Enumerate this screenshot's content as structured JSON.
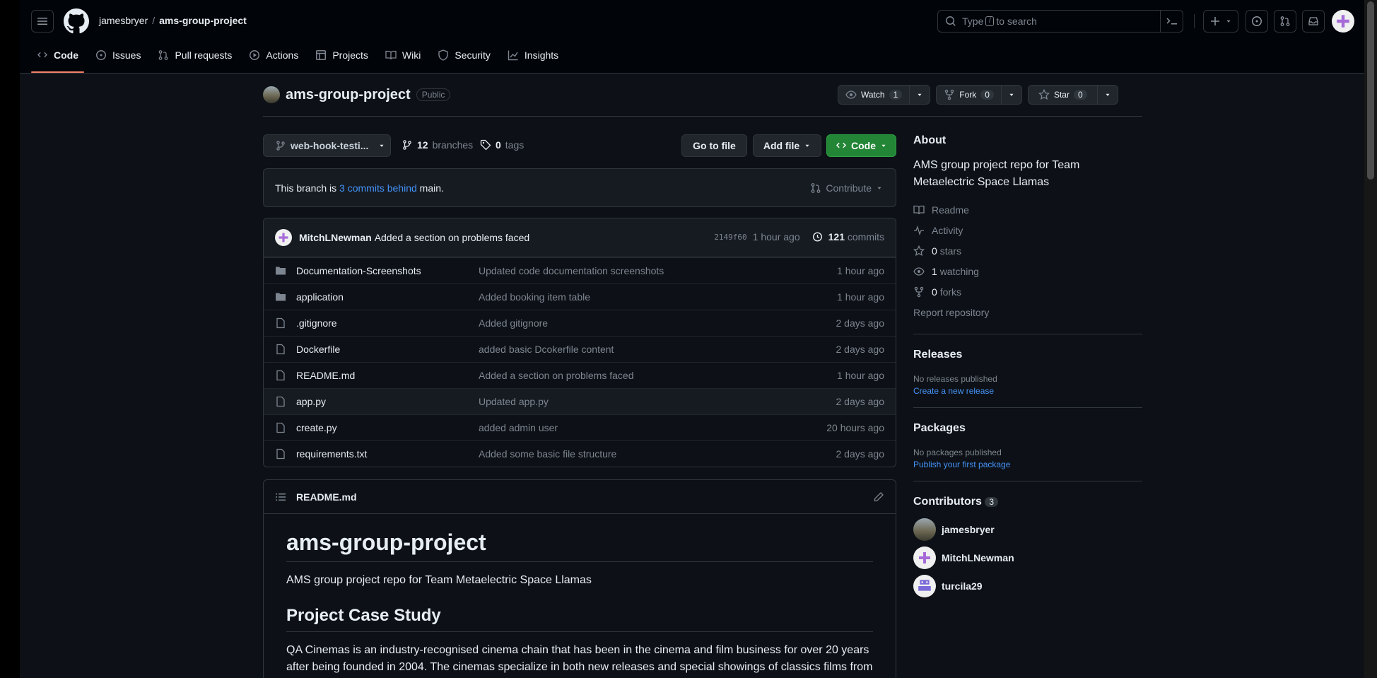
{
  "header": {
    "owner": "jamesbryer",
    "separator": "/",
    "repo": "ams-group-project",
    "search_prefix": "Type",
    "search_key": "/",
    "search_suffix": "to search"
  },
  "tabs": [
    {
      "label": "Code",
      "icon": "code-icon"
    },
    {
      "label": "Issues",
      "icon": "issue-icon"
    },
    {
      "label": "Pull requests",
      "icon": "pull-request-icon"
    },
    {
      "label": "Actions",
      "icon": "play-icon"
    },
    {
      "label": "Projects",
      "icon": "table-icon"
    },
    {
      "label": "Wiki",
      "icon": "book-icon"
    },
    {
      "label": "Security",
      "icon": "shield-icon"
    },
    {
      "label": "Insights",
      "icon": "graph-icon"
    }
  ],
  "repo_title": {
    "name": "ams-group-project",
    "visibility": "Public",
    "watch_label": "Watch",
    "watch_count": "1",
    "fork_label": "Fork",
    "fork_count": "0",
    "star_label": "Star",
    "star_count": "0"
  },
  "branch_bar": {
    "branch": "web-hook-testi...",
    "branches_count": "12",
    "branches_label": "branches",
    "tags_count": "0",
    "tags_label": "tags",
    "goto_label": "Go to file",
    "add_label": "Add file",
    "code_label": "Code"
  },
  "behind": {
    "prefix": "This branch is",
    "link": "3 commits behind",
    "suffix": "main.",
    "contribute": "Contribute"
  },
  "latest_commit": {
    "author": "MitchLNewman",
    "message": "Added a section on problems faced",
    "sha": "2149f60",
    "time": "1 hour ago",
    "commits_count": "121",
    "commits_label": "commits"
  },
  "files": [
    {
      "type": "folder",
      "name": "Documentation-Screenshots",
      "message": "Updated code documentation screenshots",
      "age": "1 hour ago"
    },
    {
      "type": "folder",
      "name": "application",
      "message": "Added booking item table",
      "age": "1 hour ago"
    },
    {
      "type": "file",
      "name": ".gitignore",
      "message": "Added gitignore",
      "age": "2 days ago"
    },
    {
      "type": "file",
      "name": "Dockerfile",
      "message": "added basic Dcokerfile content",
      "age": "2 days ago"
    },
    {
      "type": "file",
      "name": "README.md",
      "message": "Added a section on problems faced",
      "age": "1 hour ago"
    },
    {
      "type": "file",
      "name": "app.py",
      "message": "Updated app.py",
      "age": "2 days ago"
    },
    {
      "type": "file",
      "name": "create.py",
      "message": "added admin user",
      "age": "20 hours ago"
    },
    {
      "type": "file",
      "name": "requirements.txt",
      "message": "Added some basic file structure",
      "age": "2 days ago"
    }
  ],
  "readme": {
    "filename": "README.md",
    "h1": "ams-group-project",
    "p1": "AMS group project repo for Team Metaelectric Space Llamas",
    "h2": "Project Case Study",
    "p2": "QA Cinemas is an industry-recognised cinema chain that has been in the cinema and film business for over 20 years after being founded in 2004. The cinemas specialize in both new releases and special showings of classics films from"
  },
  "about": {
    "title": "About",
    "description": "AMS group project repo for Team Metaelectric Space Llamas",
    "readme": "Readme",
    "activity": "Activity",
    "stars_count": "0",
    "stars_label": "stars",
    "watching_count": "1",
    "watching_label": "watching",
    "forks_count": "0",
    "forks_label": "forks",
    "report": "Report repository"
  },
  "releases": {
    "title": "Releases",
    "none": "No releases published",
    "create": "Create a new release"
  },
  "packages": {
    "title": "Packages",
    "none": "No packages published",
    "publish": "Publish your first package"
  },
  "contributors": {
    "title": "Contributors",
    "count": "3",
    "people": [
      "jamesbryer",
      "MitchLNewman",
      "turcila29"
    ]
  },
  "colors": {
    "accent_link": "#4493f8",
    "code_button": "#238636",
    "tab_underline": "#f78166"
  }
}
